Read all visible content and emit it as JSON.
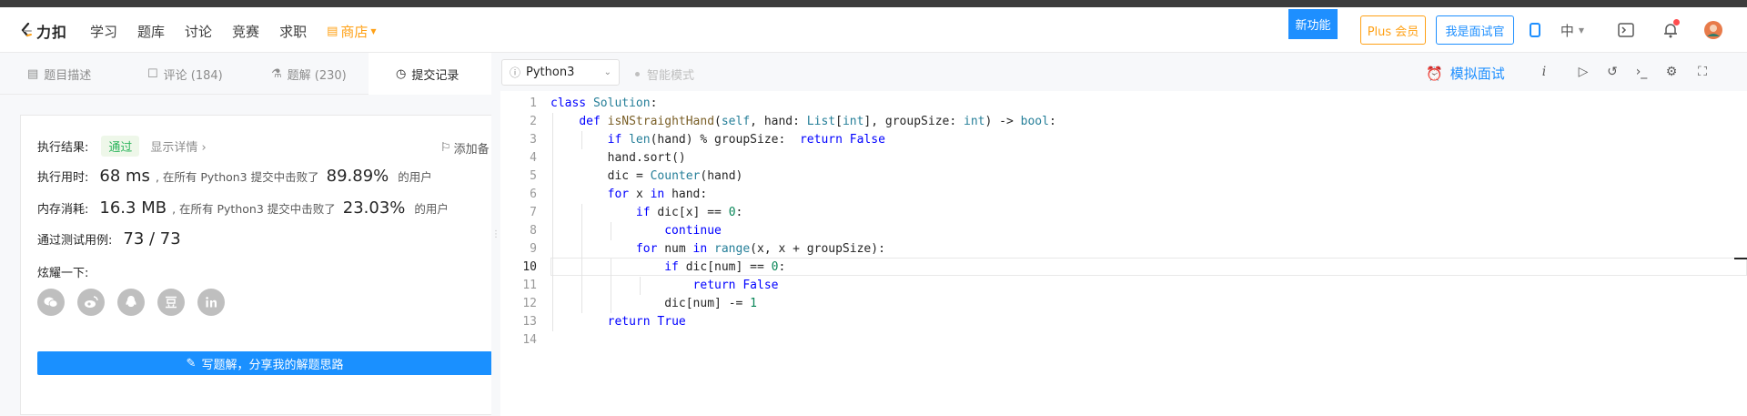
{
  "navbar": {
    "logo_text": "力扣",
    "links": [
      "学习",
      "题库",
      "讨论",
      "竞赛",
      "求职"
    ],
    "store": "商店",
    "new_feature": "新功能",
    "plus": "Plus 会员",
    "interviewer": "我是面试官",
    "lang": "中"
  },
  "tabs": [
    {
      "label": "题目描述"
    },
    {
      "label": "评论 (184)"
    },
    {
      "label": "题解 (230)"
    },
    {
      "label": "提交记录"
    }
  ],
  "result": {
    "status_label": "执行结果:",
    "status": "通过",
    "detail": "显示详情",
    "add_note": "添加备",
    "time_label": "执行用时:",
    "time_value": "68 ms",
    "time_mid": ", 在所有 Python3 提交中击败了",
    "time_pct": "89.89%",
    "time_tail": "的用户",
    "mem_label": "内存消耗:",
    "mem_value": "16.3 MB",
    "mem_mid": ", 在所有 Python3 提交中击败了",
    "mem_pct": "23.03%",
    "mem_tail": "的用户",
    "cases_label": "通过测试用例:",
    "cases_value": "73 / 73",
    "share_label": "炫耀一下:",
    "share_icons": [
      "wechat-icon",
      "weibo-icon",
      "qq-icon",
      "douban-icon",
      "linkedin-icon"
    ],
    "write_btn": "写题解，分享我的解题思路"
  },
  "editor": {
    "language": "Python3",
    "smart_mode": "智能模式",
    "mock_interview": "模拟面试",
    "current_line": 10,
    "lines": [
      "class Solution:",
      "    def isNStraightHand(self, hand: List[int], groupSize: int) -> bool:",
      "        if len(hand) % groupSize:  return False",
      "        hand.sort()",
      "        dic = Counter(hand)",
      "        for x in hand:",
      "            if dic[x] == 0:",
      "                continue",
      "            for num in range(x, x + groupSize):",
      "                if dic[num] == 0:",
      "                    return False",
      "                dic[num] -= 1",
      "        return True",
      ""
    ]
  },
  "colors": {
    "accent": "#1e8fff",
    "store": "#ffa116",
    "passed": "#2db55d"
  }
}
